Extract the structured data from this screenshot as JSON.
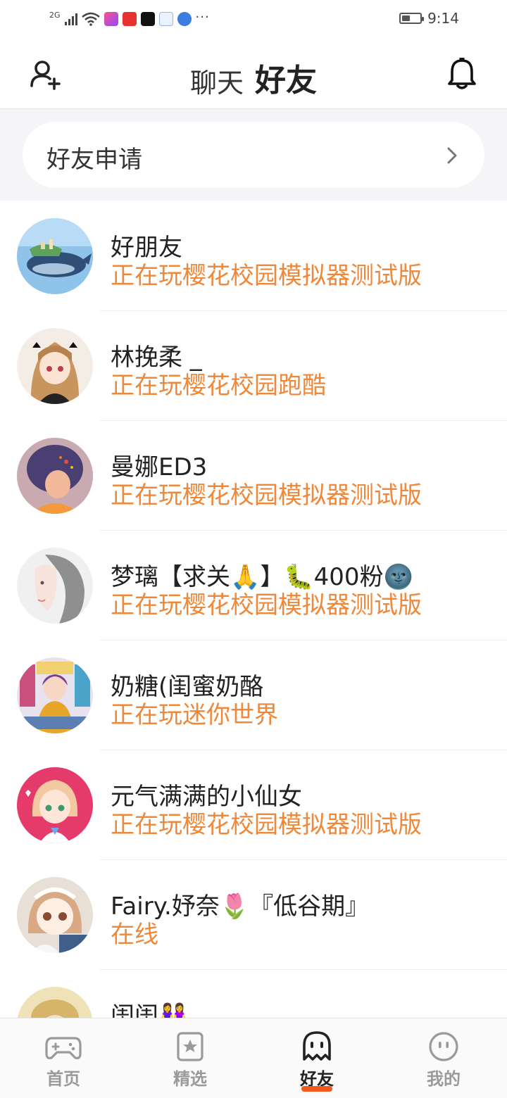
{
  "status_bar": {
    "network": "2G",
    "time": "9:14",
    "battery_level": 0.45,
    "app_icons": [
      "video-app-icon",
      "news-app-icon",
      "tiktok-icon",
      "ai-app-icon",
      "browser-icon"
    ],
    "more": "···"
  },
  "header": {
    "tab_chat": "聊天",
    "tab_friends": "好友",
    "active_tab": "好友"
  },
  "friend_request": {
    "label": "好友申请"
  },
  "friends": [
    {
      "name": "好朋友",
      "status": "正在玩樱花校园模拟器测试版"
    },
    {
      "name": "林挽柔 _",
      "status": "正在玩樱花校园跑酷"
    },
    {
      "name": "曼娜ED3",
      "status": "正在玩樱花校园模拟器测试版"
    },
    {
      "name": "梦璃【求关🙏】🐛400粉🌚",
      "status": "正在玩樱花校园模拟器测试版"
    },
    {
      "name": "奶糖(闺蜜奶酪",
      "status": "正在玩迷你世界"
    },
    {
      "name": "元气满满的小仙女",
      "status": "正在玩樱花校园模拟器测试版"
    },
    {
      "name": "Fairy.妤奈🌷『低谷期』",
      "status": "在线"
    },
    {
      "name": "闺闺👭",
      "status": ""
    }
  ],
  "bottom_nav": {
    "items": [
      {
        "label": "首页",
        "icon": "gamepad-icon"
      },
      {
        "label": "精选",
        "icon": "star-badge-icon"
      },
      {
        "label": "好友",
        "icon": "ghost-icon"
      },
      {
        "label": "我的",
        "icon": "face-icon"
      }
    ],
    "active_index": 2
  },
  "colors": {
    "accent": "#f05a1e",
    "status_text": "#f0883a",
    "request_bg": "#f5f5f7"
  }
}
